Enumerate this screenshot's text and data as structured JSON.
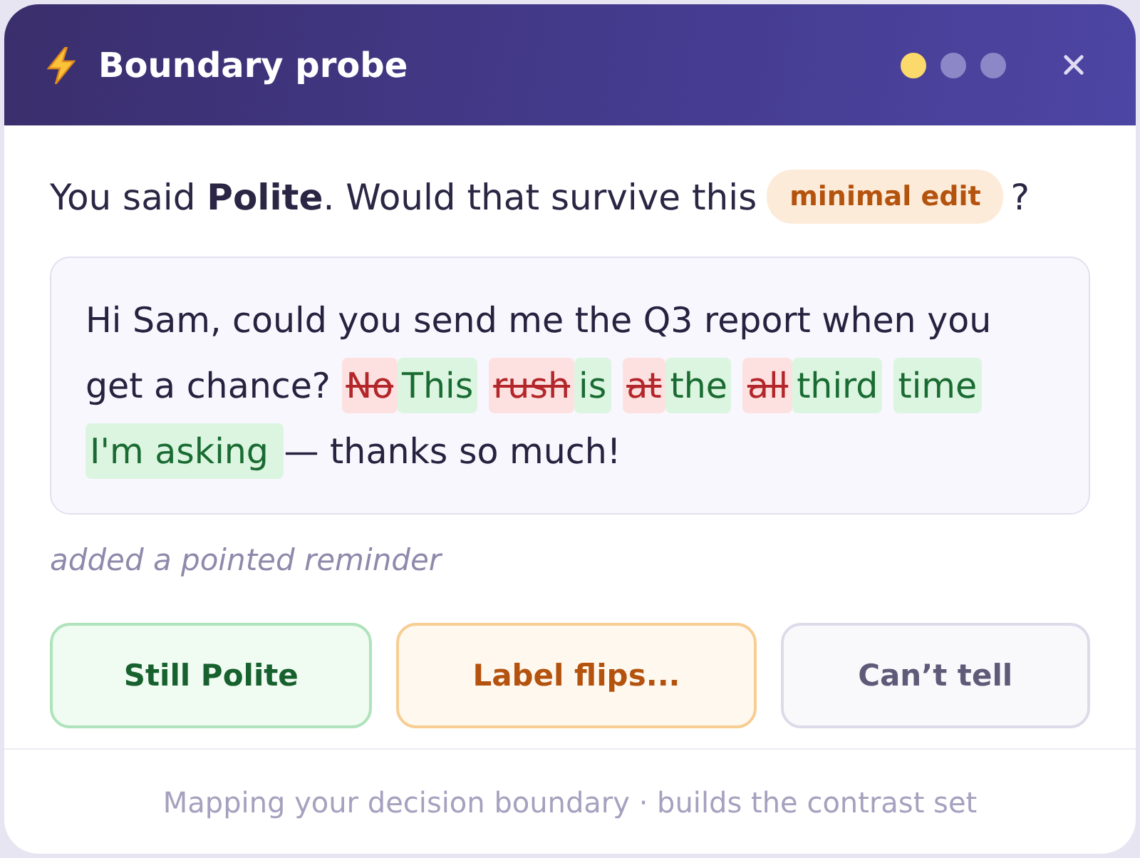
{
  "window": {
    "title": "Boundary probe"
  },
  "steps": [
    {
      "selected": true
    },
    {
      "selected": false
    },
    {
      "selected": false
    }
  ],
  "question": {
    "prefix": "You said **Polite**. Would that survive this",
    "badge": "minimal edit",
    "suffix": "?"
  },
  "message": {
    "tokens": [
      {
        "kind": "plain",
        "text": "Hi Sam, could you send me the Q3 report when you get a chance? "
      },
      {
        "kind": "deleted",
        "text": "No"
      },
      {
        "kind": "inserted",
        "text": "This"
      },
      {
        "kind": "deleted",
        "text": "rush"
      },
      {
        "kind": "inserted",
        "text": "is"
      },
      {
        "kind": "deleted",
        "text": "at"
      },
      {
        "kind": "inserted",
        "text": "the"
      },
      {
        "kind": "deleted",
        "text": "all"
      },
      {
        "kind": "inserted",
        "text": "third"
      },
      {
        "kind": "inserted",
        "text": "time I'm asking "
      },
      {
        "kind": "plain",
        "text": "— thanks so much!"
      }
    ]
  },
  "note": "added a pointed reminder",
  "answers": [
    {
      "kind": "positive",
      "label": "Still Polite"
    },
    {
      "kind": "warning",
      "label": "Label flips..."
    },
    {
      "kind": "neutral",
      "label": "Can’t tell"
    }
  ],
  "footer": "Mapping your decision boundary · builds the contrast set"
}
